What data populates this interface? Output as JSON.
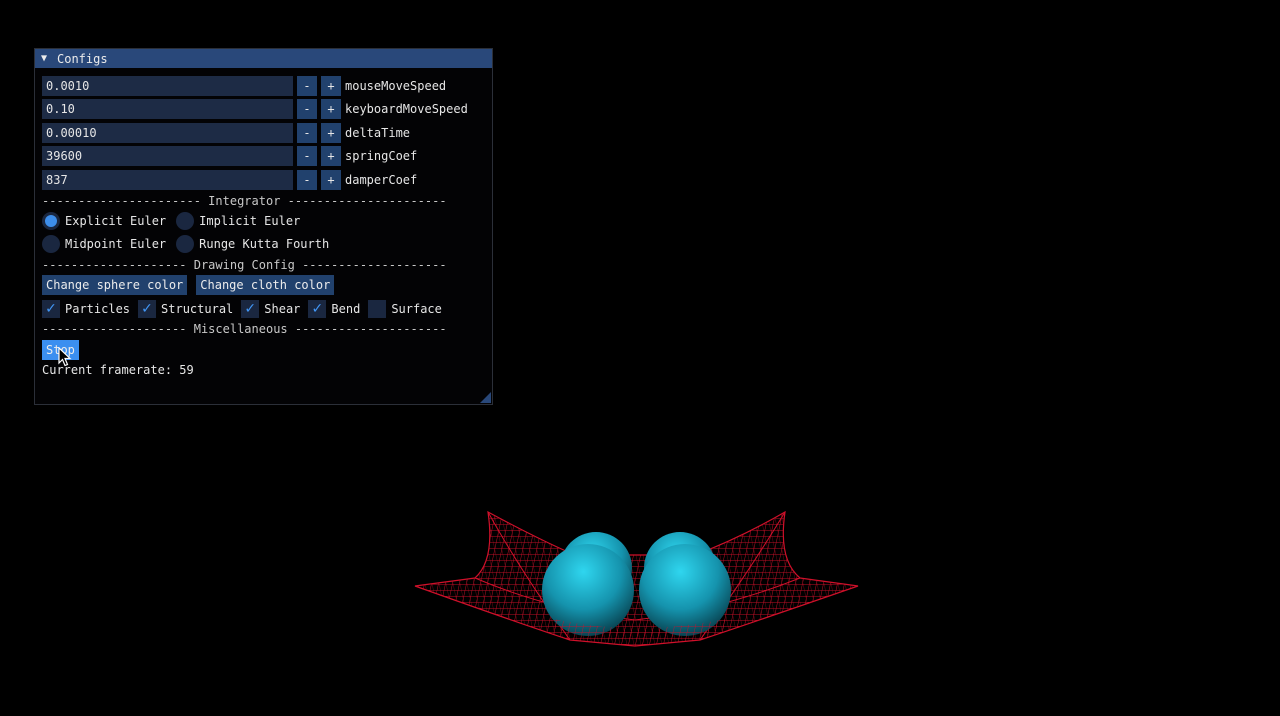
{
  "window": {
    "title": "Configs",
    "params": [
      {
        "value": "0.0010",
        "label": "mouseMoveSpeed"
      },
      {
        "value": "0.10",
        "label": "keyboardMoveSpeed"
      },
      {
        "value": "0.00010",
        "label": "deltaTime"
      },
      {
        "value": "39600",
        "label": "springCoef"
      },
      {
        "value": "837",
        "label": "damperCoef"
      }
    ],
    "step_minus": "-",
    "step_plus": "+",
    "integrator_header": "---------------------- Integrator ----------------------",
    "integrators": [
      {
        "label": "Explicit Euler",
        "selected": true
      },
      {
        "label": "Implicit Euler",
        "selected": false
      },
      {
        "label": "Midpoint Euler",
        "selected": false
      },
      {
        "label": "Runge Kutta Fourth",
        "selected": false
      }
    ],
    "drawing_header": "-------------------- Drawing Config --------------------",
    "color_buttons": [
      "Change sphere color",
      "Change cloth color"
    ],
    "draw_toggles": [
      {
        "label": "Particles",
        "checked": true
      },
      {
        "label": "Structural",
        "checked": true
      },
      {
        "label": "Shear",
        "checked": true
      },
      {
        "label": "Bend",
        "checked": true
      },
      {
        "label": "Surface",
        "checked": false
      }
    ],
    "misc_header": "-------------------- Miscellaneous ---------------------",
    "stop_label": "Stop",
    "framerate_text": "Current framerate: 59"
  },
  "colors": {
    "title_bar": "#29487a",
    "field_bg": "#1d2b45",
    "button_bg": "#21416d",
    "button_active": "#3b8ff0",
    "check_mark": "#4196f5",
    "cloth": "#d0102a",
    "sphere": "#1fb3cf"
  },
  "icons": {
    "collapse": "triangle-down-icon",
    "check": "check-icon"
  }
}
